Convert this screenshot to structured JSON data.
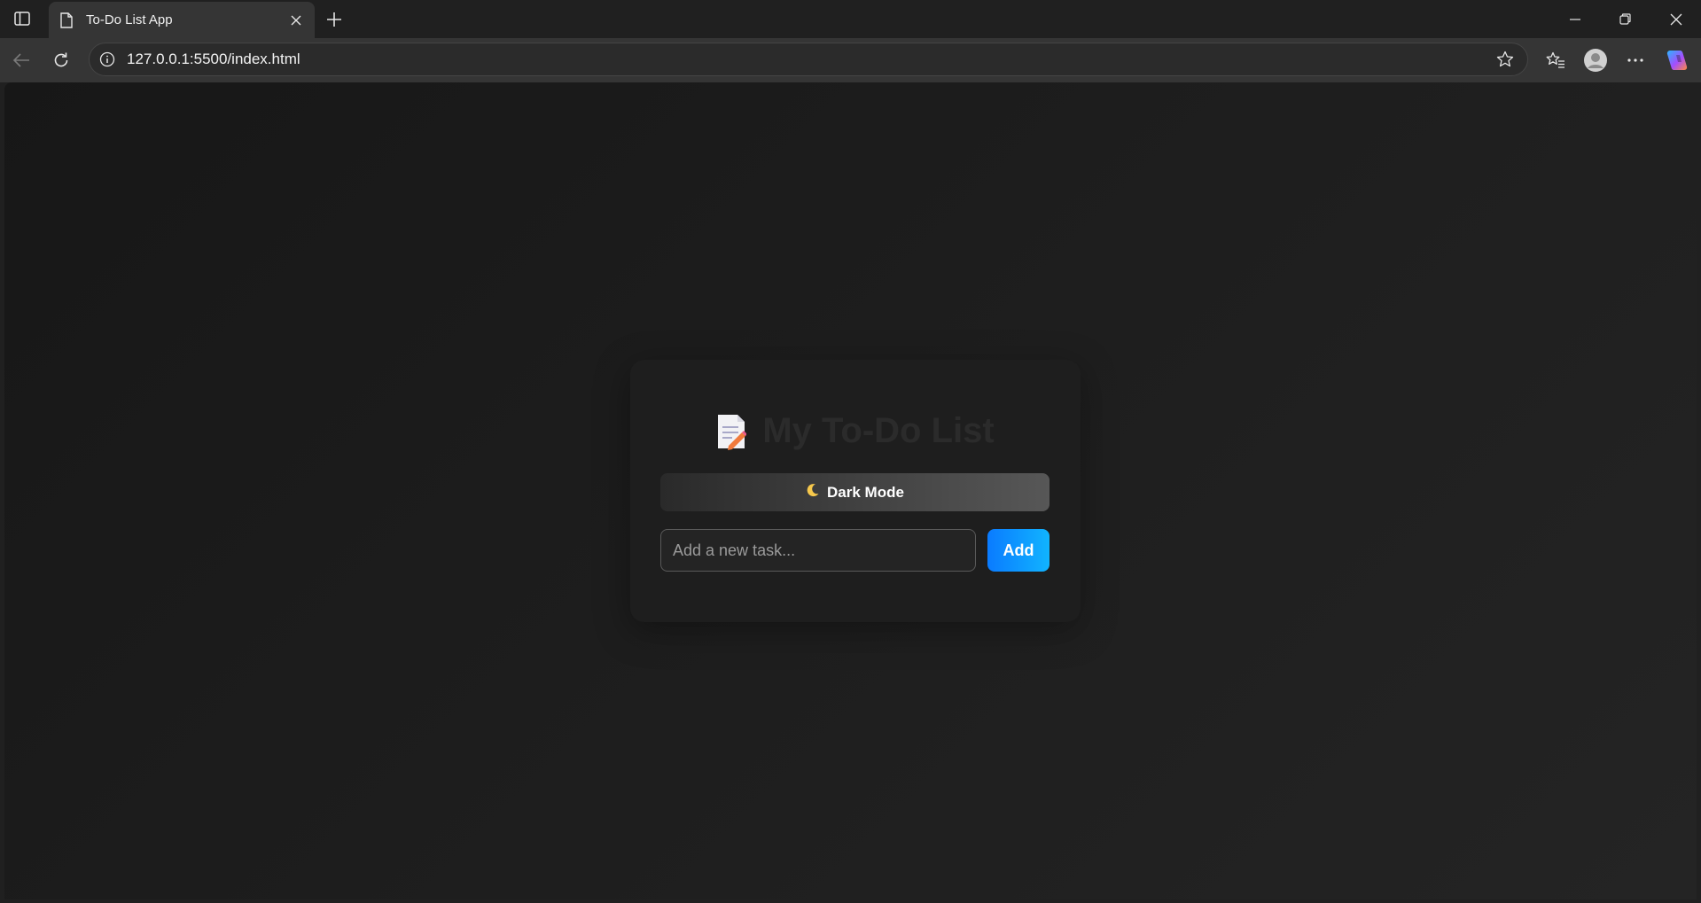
{
  "browser": {
    "tab": {
      "title": "To-Do List App",
      "icon": "page-icon"
    },
    "address_bar": {
      "url": "127.0.0.1:5500/index.html",
      "icon": "info-icon"
    },
    "accent_copilot": [
      "#2bb5ff",
      "#a44dff",
      "#ff8a3d"
    ]
  },
  "app": {
    "title": "My To-Do List",
    "title_icon": "memo-icon",
    "mode_button": {
      "icon": "crescent-moon-icon",
      "label": "Dark Mode"
    },
    "task_input": {
      "placeholder": "Add a new task...",
      "value": ""
    },
    "add_button": {
      "label": "Add",
      "color_from": "#0a7bff",
      "color_to": "#11b4ff"
    }
  }
}
